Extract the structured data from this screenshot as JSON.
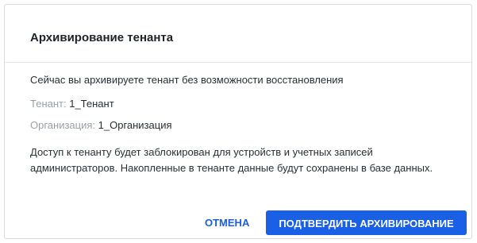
{
  "dialog": {
    "title": "Архивирование тенанта",
    "intro": "Сейчас вы архивируете тенант без возможности восстановления",
    "tenant_label": "Тенант:",
    "tenant_value": "1_Тенант",
    "org_label": "Организация:",
    "org_value": "1_Организация",
    "notice_line1": "Доступ к тенанту будет заблокирован для устройств и учетных записей",
    "notice_line2": "администраторов. Накопленные в тенанте данные будут сохранены в базе данных.",
    "cancel_label": "ОТМЕНА",
    "confirm_label": "ПОДТВЕРДИТЬ АРХИВИРОВАНИЕ"
  },
  "colors": {
    "primary": "#1960e6",
    "muted_text": "#9aa1ab",
    "border": "#d9dde3"
  }
}
